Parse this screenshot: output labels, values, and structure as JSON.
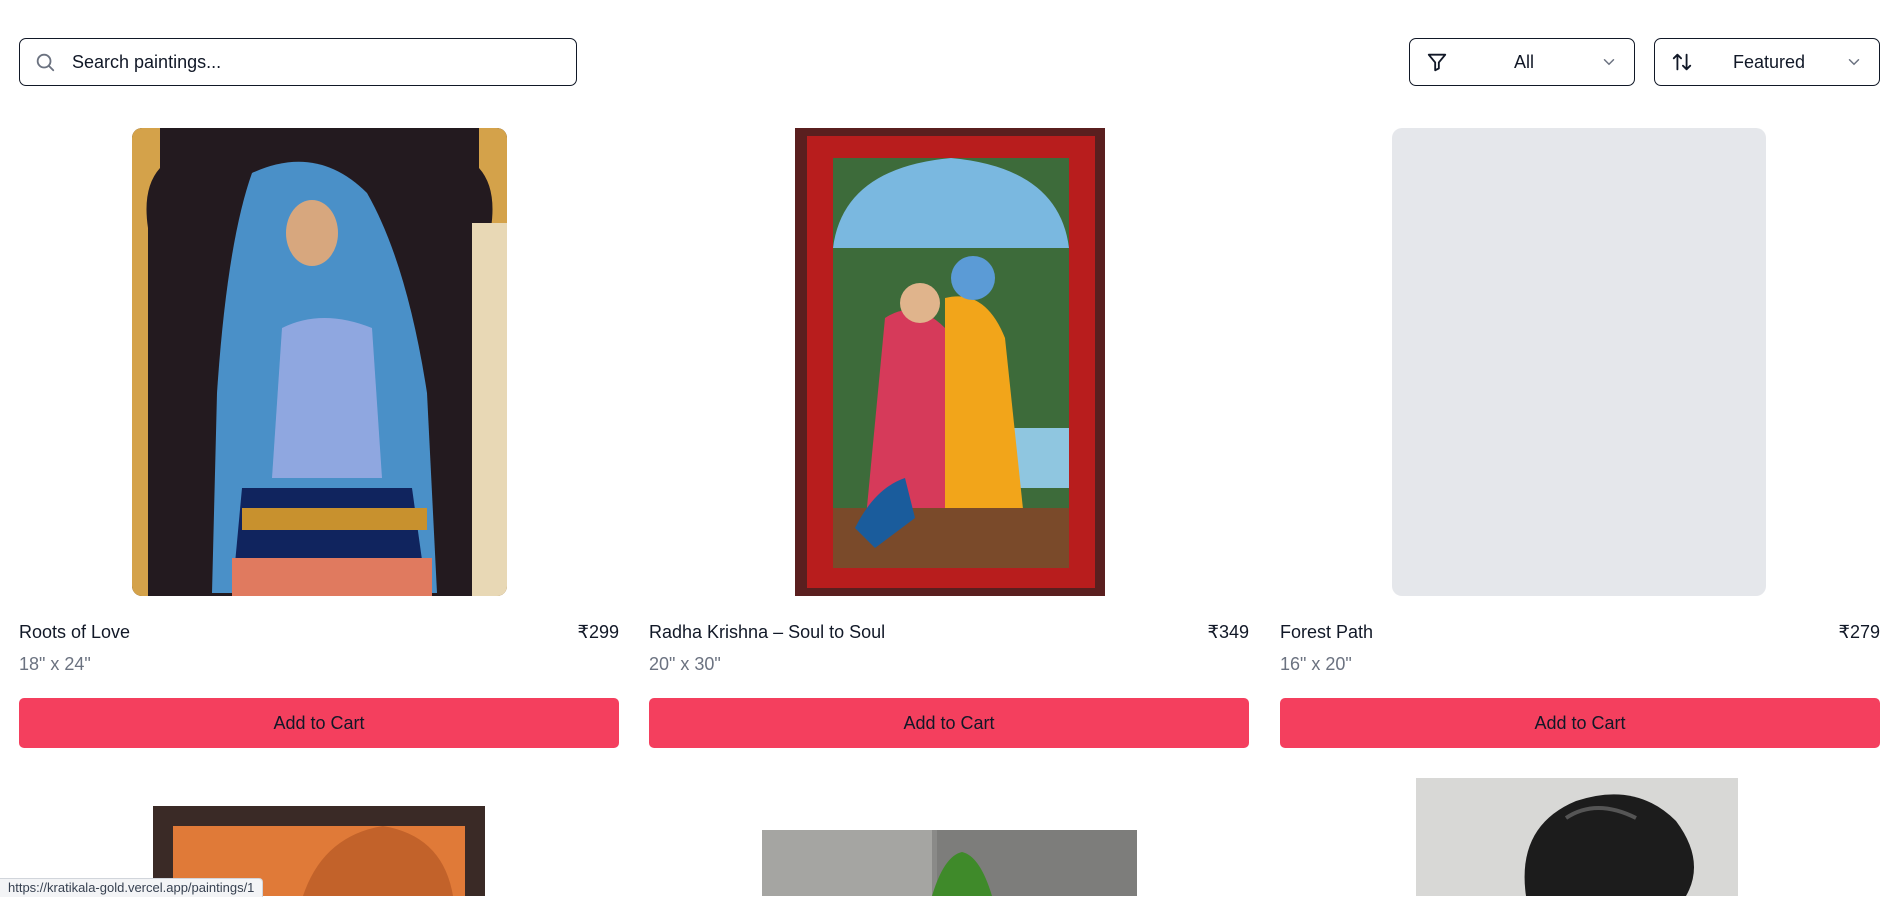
{
  "search": {
    "placeholder": "Search paintings..."
  },
  "filter": {
    "value": "All"
  },
  "sort": {
    "value": "Featured"
  },
  "add_to_cart_label": "Add to Cart",
  "products": [
    {
      "title": "Roots of Love",
      "price": "₹299",
      "size": "18\" x 24\""
    },
    {
      "title": "Radha Krishna – Soul to Soul",
      "price": "₹349",
      "size": "20\" x 30\""
    },
    {
      "title": "Forest Path",
      "price": "₹279",
      "size": "16\" x 20\""
    }
  ],
  "status_url": "https://kratikala-gold.vercel.app/paintings/1",
  "colors": {
    "accent": "#f43f5e",
    "border": "#111827",
    "muted": "#6b7280",
    "placeholder_image": "#e5e7eb"
  }
}
